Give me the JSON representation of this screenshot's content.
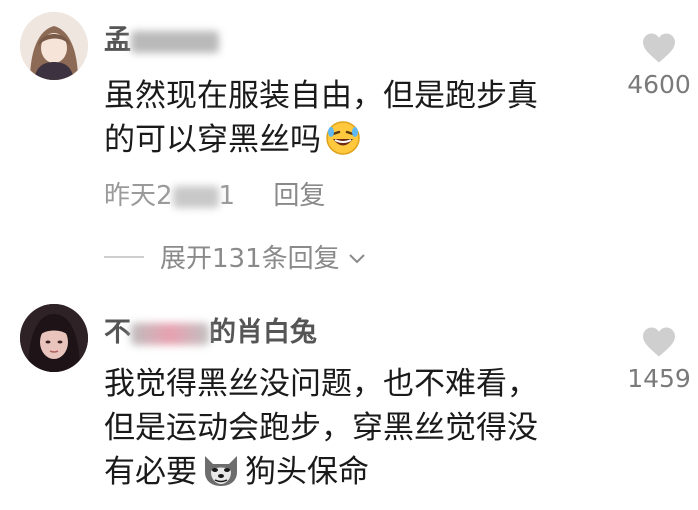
{
  "comments": [
    {
      "username_visible_start": "孟",
      "username_visible_end": "",
      "text_line1": "虽然现在服装自由，但是跑步真",
      "text_line2": "的可以穿黑丝吗",
      "emoji": "rolling-on-floor-laughing-emoji",
      "like_count": "4600",
      "time_prefix": "昨天2",
      "time_suffix": "1",
      "reply_label": "回复",
      "expand_label": "展开131条回复"
    },
    {
      "username_visible_start": "不",
      "username_visible_end": "的肖白兔",
      "text_line1": "我觉得黑丝没问题，也不难看，",
      "text_line2": "但是运动会跑步，穿黑丝觉得没",
      "text_line3_a": "有必要",
      "text_line3_b": "狗头保命",
      "emoji": "doge-emoji",
      "like_count": "1459"
    }
  ]
}
